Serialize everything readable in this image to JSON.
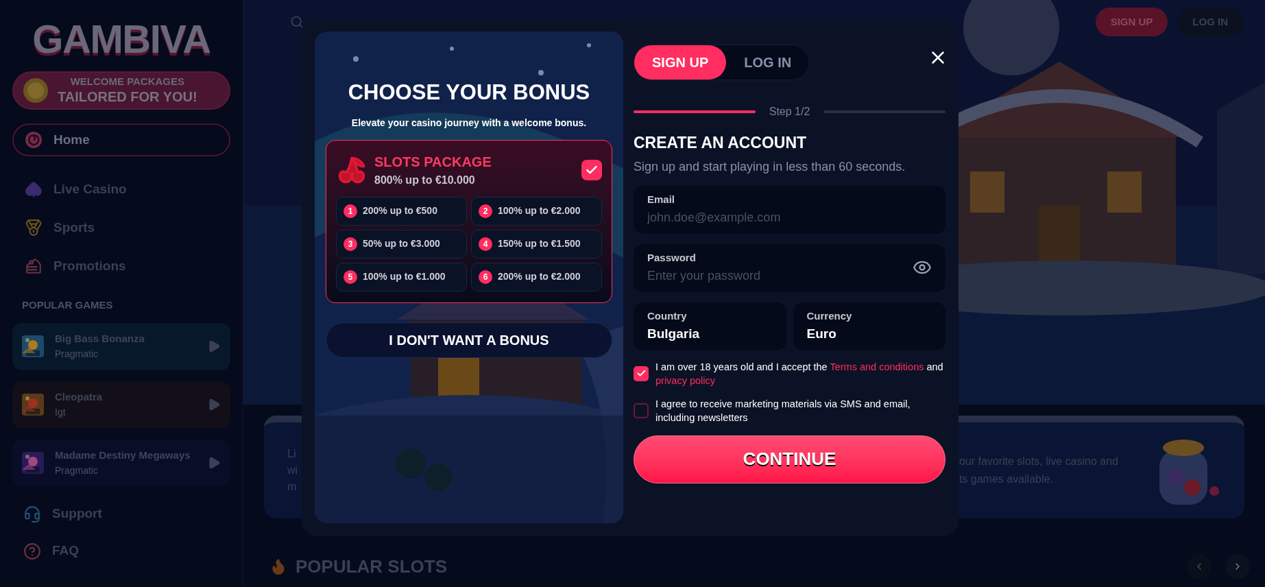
{
  "sidebar": {
    "logo": "GAMBIVA",
    "promo_banner": {
      "line1": "WELCOME PACKAGES",
      "line2": "TAILORED FOR YOU!"
    },
    "nav_items": [
      {
        "label": "Home",
        "selected": true,
        "kind": "candy"
      },
      {
        "label": "Live Casino",
        "selected": false,
        "kind": "spade"
      },
      {
        "label": "Sports",
        "selected": false,
        "kind": "medal"
      },
      {
        "label": "Promotions",
        "selected": false,
        "kind": "cake"
      }
    ],
    "section_title": "POPULAR GAMES",
    "games": [
      {
        "title": "Big Bass Bonanza",
        "provider": "Pragmatic"
      },
      {
        "title": "Cleopatra",
        "provider": "Igt"
      },
      {
        "title": "Madame Destiny Megaways",
        "provider": "Pragmatic"
      }
    ],
    "footer_items": [
      {
        "label": "Support",
        "kind": "headset"
      },
      {
        "label": "FAQ",
        "kind": "help"
      }
    ]
  },
  "header": {
    "buttons": [
      {
        "label": "SIGN UP",
        "kind": "primary"
      },
      {
        "label": "LOG IN",
        "kind": "secondary"
      }
    ]
  },
  "background": {
    "banner_left_lines": [
      "Li",
      "wi",
      "m"
    ],
    "banner_right_lines": [
      "our favorite slots, live casino and",
      "ts games available."
    ],
    "section_title": "POPULAR SLOTS"
  },
  "modal": {
    "bonus": {
      "title": "CHOOSE YOUR BONUS",
      "subtitle": "Elevate your casino journey with a welcome bonus.",
      "package": {
        "name": "SLOTS PACKAGE",
        "amount": "800% up to €10.000",
        "checked": true,
        "offers": [
          {
            "number": "1",
            "text": "200% up to €500"
          },
          {
            "number": "2",
            "text": "100% up to €2.000"
          },
          {
            "number": "3",
            "text": "50% up to €3.000"
          },
          {
            "number": "4",
            "text": "150% up to €1.500"
          },
          {
            "number": "5",
            "text": "100% up to €1.000"
          },
          {
            "number": "6",
            "text": "200% up to €2.000"
          }
        ]
      },
      "decline_button": "I DON'T WANT A BONUS"
    },
    "form": {
      "tabs": [
        {
          "label": "SIGN UP",
          "selected": true
        },
        {
          "label": "LOG IN",
          "selected": false
        }
      ],
      "progress": {
        "label": "Step 1/2",
        "segments": [
          {
            "complete": true
          },
          {
            "complete": false
          }
        ]
      },
      "title": "CREATE AN ACCOUNT",
      "subtitle": "Sign up and start playing in less than 60 seconds.",
      "email": {
        "label": "Email",
        "placeholder": "john.doe@example.com"
      },
      "password": {
        "label": "Password",
        "placeholder": "Enter your password"
      },
      "country": {
        "label": "Country",
        "value": "Bulgaria"
      },
      "currency": {
        "label": "Currency",
        "value": "Euro"
      },
      "consents": [
        {
          "checked": true,
          "segments": [
            {
              "text": "I am over 18 years old and I accept the ",
              "kind": "text"
            },
            {
              "text": "Terms and conditions",
              "kind": "link"
            },
            {
              "text": " and ",
              "kind": "text"
            },
            {
              "text": "privacy policy",
              "kind": "link"
            }
          ]
        },
        {
          "checked": false,
          "segments": [
            {
              "text": "I agree to receive marketing materials via SMS and email, including newsletters",
              "kind": "text"
            }
          ]
        }
      ],
      "submit": "CONTINUE"
    }
  }
}
